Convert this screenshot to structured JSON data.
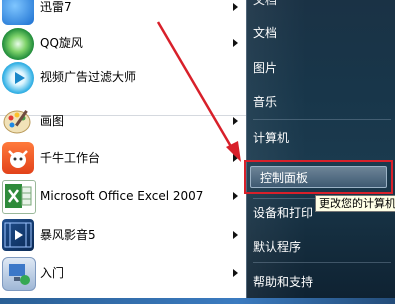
{
  "programs": [
    {
      "label": "迅雷7",
      "has_arrow": true,
      "icon": "xunlei-icon"
    },
    {
      "label": "QQ旋风",
      "has_arrow": true,
      "icon": "qq-xuanfeng-icon"
    },
    {
      "label": "视频广告过滤大师",
      "has_arrow": false,
      "icon": "video-ad-filter-icon"
    },
    {
      "label": "画图",
      "has_arrow": true,
      "icon": "paint-icon"
    },
    {
      "label": "千牛工作台",
      "has_arrow": true,
      "icon": "qianniu-icon"
    },
    {
      "label": "Microsoft Office Excel 2007",
      "has_arrow": true,
      "icon": "excel-icon"
    },
    {
      "label": "暴风影音5",
      "has_arrow": true,
      "icon": "baofeng-icon"
    },
    {
      "label": "入门",
      "has_arrow": true,
      "icon": "getting-started-icon"
    }
  ],
  "right_menu": {
    "top_partial": "文档",
    "documents": "文档",
    "pictures": "图片",
    "music": "音乐",
    "computer": "计算机",
    "control_panel": "控制面板",
    "devices_printers": "设备和打印",
    "default_programs": "默认程序",
    "help_support": "帮助和支持"
  },
  "tooltip": "更改您的计算机",
  "colors": {
    "highlight_border": "#d8202a",
    "arrow": "#d8202a",
    "right_pane_bg": "#18364a"
  }
}
